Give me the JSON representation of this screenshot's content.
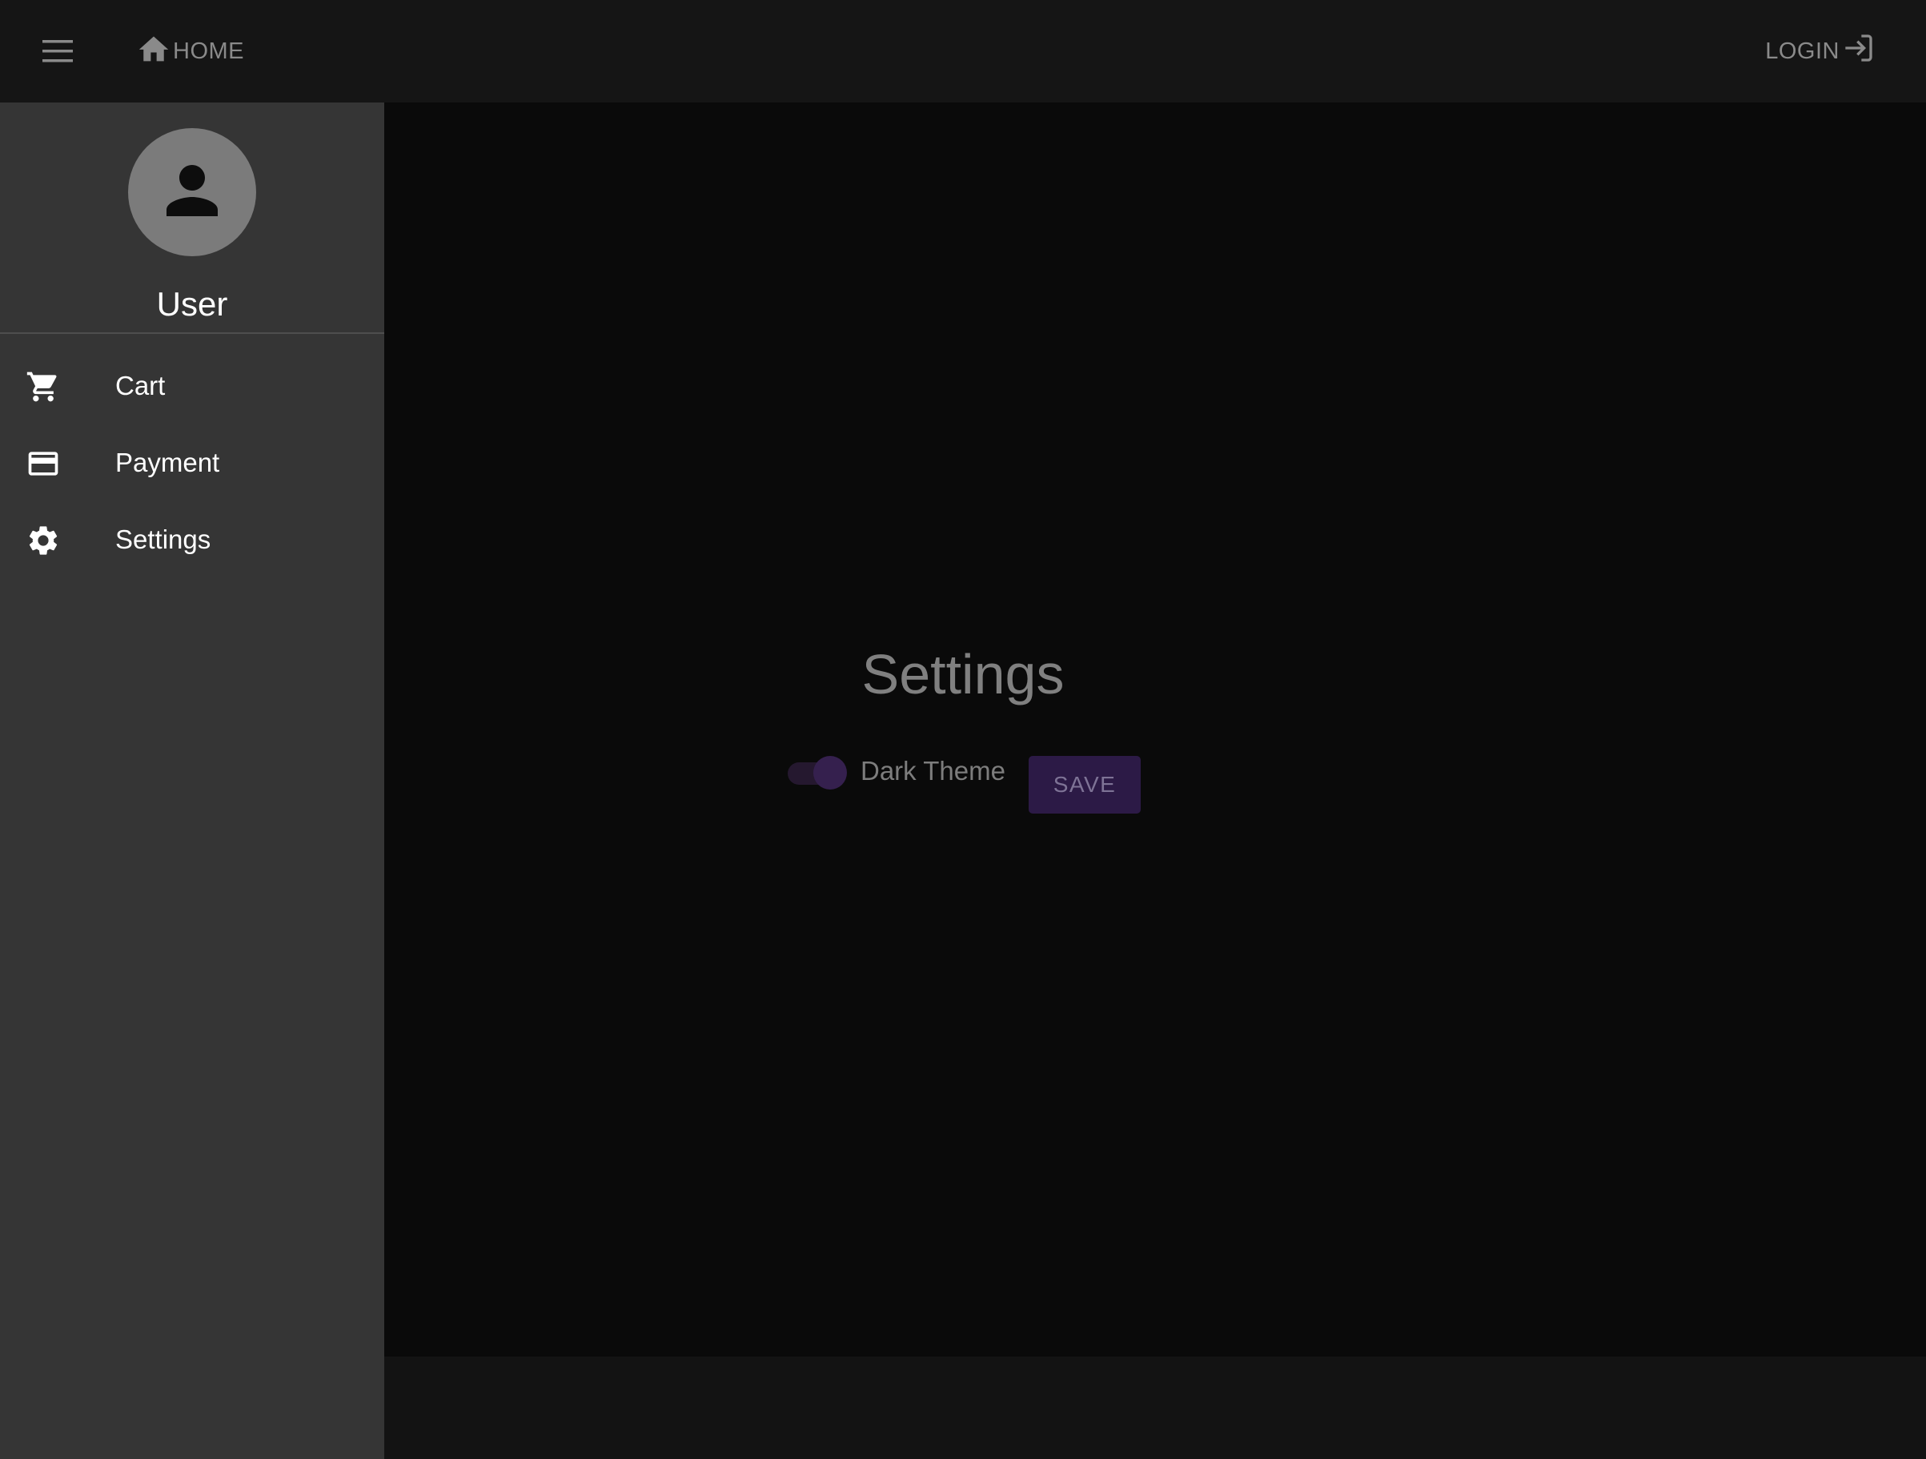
{
  "topbar": {
    "menu_icon": "hamburger-menu-icon",
    "home": {
      "icon": "home-icon",
      "label": "HOME"
    },
    "login": {
      "label": "LOGIN",
      "icon": "login-icon"
    }
  },
  "drawer": {
    "avatar_icon": "person-icon",
    "user_name": "User",
    "items": [
      {
        "icon": "cart-icon",
        "label": "Cart"
      },
      {
        "icon": "credit-card-icon",
        "label": "Payment"
      },
      {
        "icon": "gear-icon",
        "label": "Settings"
      }
    ]
  },
  "main": {
    "title": "Settings",
    "dark_theme": {
      "label": "Dark Theme",
      "enabled": true
    },
    "save_label": "SAVE"
  },
  "colors": {
    "topbar_bg": "#151515",
    "drawer_bg": "#353535",
    "main_bg": "#0a0a0a",
    "accent": "#2c1a46"
  }
}
